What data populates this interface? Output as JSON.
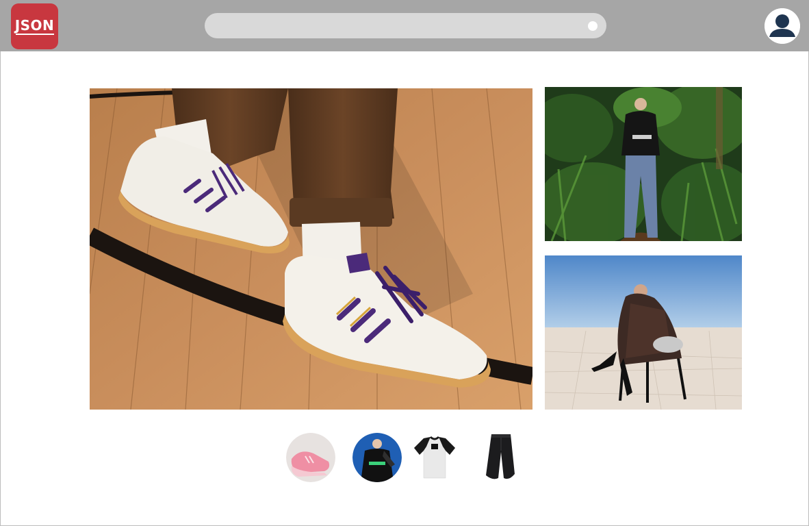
{
  "header": {
    "logo_text": "JSON",
    "search": {
      "placeholder": "",
      "value": ""
    },
    "avatar_icon": "user-avatar-icon"
  },
  "colors": {
    "header_bg": "#a6a6a6",
    "logo_bg": "#c8373f",
    "search_bg": "#d9d9d9",
    "avatar_fg": "#1f3550"
  },
  "gallery": {
    "hero_icon": "sneaker-photo",
    "side_photos": [
      "forest-streetwear-photo",
      "desert-fashion-photo"
    ]
  },
  "thumbnails": [
    {
      "icon": "pink-sneaker-news-thumbnail"
    },
    {
      "icon": "model-sweatshirt-thumbnail"
    },
    {
      "icon": "raglan-tshirt-thumbnail"
    },
    {
      "icon": "black-jeans-thumbnail"
    }
  ]
}
